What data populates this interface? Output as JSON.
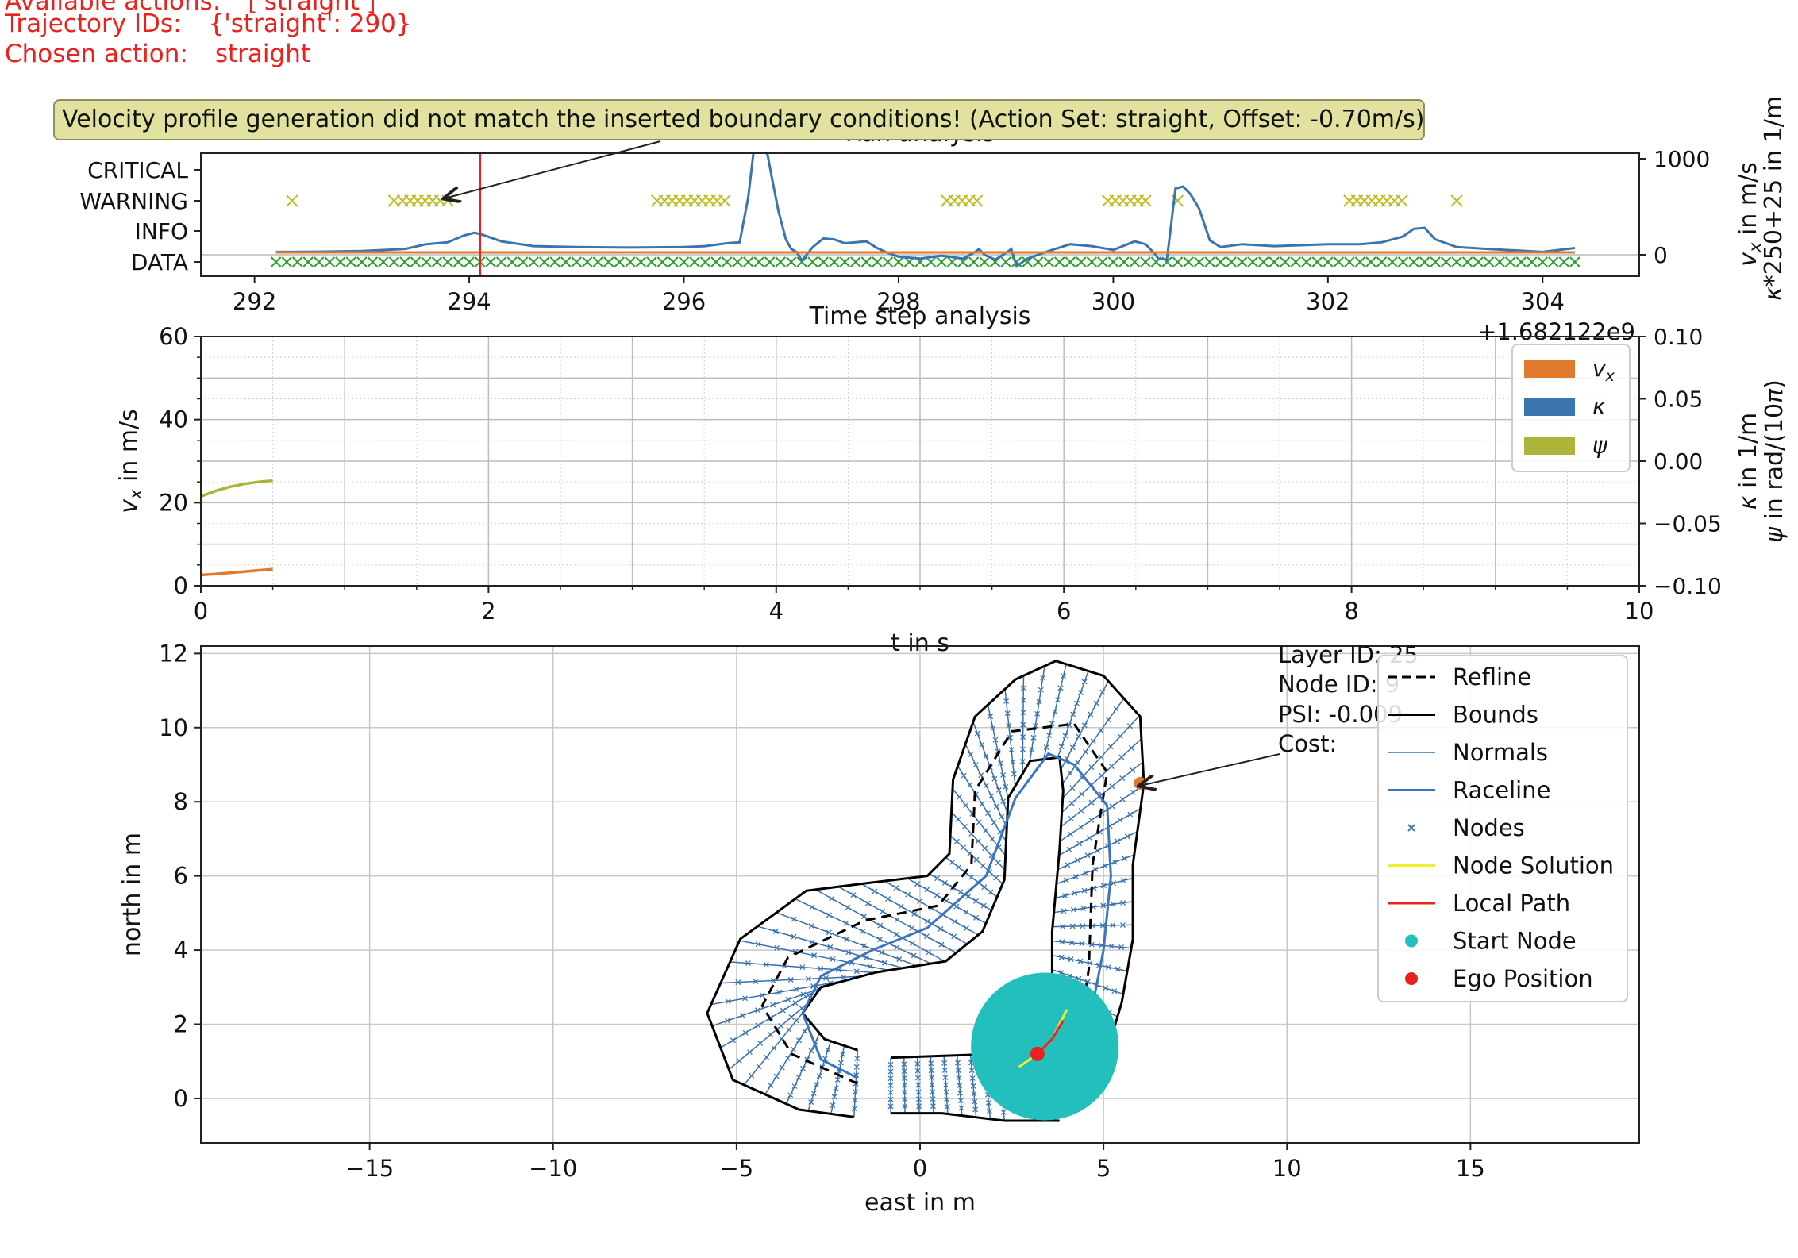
{
  "header": {
    "available_actions_label": "Available actions:",
    "available_actions_value": "['straight']",
    "trajectory_ids_label": "Trajectory IDs:",
    "trajectory_ids_value": "{'straight': 290}",
    "chosen_action_label": "Chosen action:",
    "chosen_action_value": "straight",
    "color": "#e8231f"
  },
  "warning_box": {
    "text": "Velocity profile generation did not match the inserted boundary conditions! (Action Set: straight, Offset: -0.70m/s)",
    "background": "#e2e2a0"
  },
  "chart_data": [
    {
      "type": "line",
      "title": "Run analysis",
      "xlim": [
        291.5,
        304.9
      ],
      "x_ticks": [
        "292",
        "294",
        "296",
        "298",
        "300",
        "302",
        "304"
      ],
      "x_offset_label": "+1.682122e9",
      "y_categories": [
        "DATA",
        "INFO",
        "WARNING",
        "CRITICAL"
      ],
      "y_right_label_1": "$v_x$ in m/s",
      "y_right_label_2": "$\\kappa$*250+25 in 1/m",
      "y_right_ticks": [
        "0",
        "1000"
      ],
      "selected_time": 294.1,
      "warning_marks_x": [
        292.35,
        293.3,
        293.38,
        293.45,
        293.52,
        293.59,
        293.66,
        293.73,
        293.8,
        295.75,
        295.82,
        295.89,
        295.96,
        296.03,
        296.1,
        296.17,
        296.24,
        296.31,
        296.38,
        298.45,
        298.52,
        298.59,
        298.66,
        298.73,
        299.95,
        300.02,
        300.09,
        300.16,
        300.23,
        300.3,
        300.6,
        302.2,
        302.27,
        302.34,
        302.41,
        302.48,
        302.55,
        302.62,
        302.69,
        303.2
      ],
      "data_marks": {
        "start": 292.2,
        "end": 304.3,
        "step": 0.1
      },
      "series": [
        {
          "name": "velocity",
          "color": "#3b75af",
          "x": [
            292.2,
            292.6,
            293,
            293.4,
            293.6,
            293.8,
            293.95,
            294.05,
            294.12,
            294.3,
            294.6,
            295,
            295.5,
            296,
            296.2,
            296.4,
            296.52,
            296.6,
            296.65,
            296.72,
            296.78,
            296.82,
            296.88,
            296.95,
            297,
            297.05,
            297.1,
            297.2,
            297.3,
            297.4,
            297.5,
            297.6,
            297.7,
            297.8,
            297.9,
            298,
            298.2,
            298.4,
            298.6,
            298.7,
            298.75,
            298.8,
            298.9,
            299,
            299.05,
            299.1,
            299.2,
            299.4,
            299.6,
            299.8,
            300,
            300.2,
            300.3,
            300.38,
            300.42,
            300.5,
            300.58,
            300.65,
            300.72,
            300.8,
            300.9,
            301,
            301.2,
            301.5,
            302,
            302.3,
            302.5,
            302.7,
            302.8,
            302.9,
            303,
            303.2,
            303.5,
            304,
            304.3
          ],
          "y": [
            30,
            32,
            40,
            60,
            110,
            130,
            200,
            230,
            210,
            140,
            90,
            80,
            75,
            80,
            90,
            120,
            130,
            600,
            1080,
            1160,
            1040,
            800,
            460,
            160,
            60,
            30,
            -60,
            80,
            170,
            160,
            120,
            130,
            140,
            70,
            20,
            -20,
            -40,
            -10,
            -40,
            20,
            60,
            0,
            -50,
            20,
            60,
            -120,
            -40,
            40,
            110,
            90,
            50,
            140,
            110,
            20,
            -40,
            -50,
            690,
            710,
            630,
            480,
            150,
            80,
            110,
            90,
            110,
            110,
            130,
            190,
            270,
            280,
            160,
            80,
            60,
            30,
            70
          ]
        },
        {
          "name": "curvature",
          "color": "#e07a2f",
          "x": [
            292.2,
            304.3
          ],
          "y": [
            25,
            25
          ]
        }
      ]
    },
    {
      "type": "line",
      "title": "Time step analysis",
      "xlabel": "t in s",
      "ylabel": "$v_x$ in m/s",
      "ylabel_right_1": "$\\kappa$ in 1/m",
      "ylabel_right_2": "$\\psi$ in rad/(10$\\pi$)",
      "xlim": [
        0,
        10
      ],
      "ylim": [
        0,
        60
      ],
      "ylim_right": [
        -0.1,
        0.1
      ],
      "x_ticks": [
        "0",
        "2",
        "4",
        "6",
        "8",
        "10"
      ],
      "y_ticks": [
        "0",
        "20",
        "40",
        "60"
      ],
      "y_right_ticks": [
        "−0.10",
        "−0.05",
        "0.00",
        "0.05",
        "0.10"
      ],
      "legend": [
        "v_x",
        "κ",
        "ψ"
      ],
      "legend_placement": "top-right",
      "grid": true,
      "series": [
        {
          "name": "v_x",
          "color": "#e07a2f",
          "x": [
            0,
            0.1,
            0.2,
            0.3,
            0.4,
            0.5
          ],
          "y": [
            2.6,
            2.8,
            3.1,
            3.4,
            3.7,
            4.0
          ]
        },
        {
          "name": "ψ",
          "color": "#adb43a",
          "x": [
            0,
            0.1,
            0.2,
            0.3,
            0.4,
            0.5
          ],
          "y": [
            21.5,
            22.8,
            23.8,
            24.5,
            25.0,
            25.3
          ]
        }
      ]
    },
    {
      "type": "scatter",
      "xlabel": "east in m",
      "ylabel": "north in m",
      "xlim": [
        -19.6,
        19.6
      ],
      "ylim": [
        -1.2,
        12.2
      ],
      "x_ticks": [
        "−15",
        "−10",
        "−5",
        "0",
        "5",
        "10",
        "15"
      ],
      "y_ticks": [
        "0",
        "2",
        "4",
        "6",
        "8",
        "10",
        "12"
      ],
      "grid": true,
      "legend": [
        "Refline",
        "Bounds",
        "Normals",
        "Raceline",
        "Nodes",
        "Node Solution",
        "Local Path",
        "Start Node",
        "Ego Position"
      ],
      "legend_placement": "top-right",
      "annotation": {
        "lines": [
          "Layer ID: 25",
          "Node ID: 9",
          "PSI: -0.009",
          "Cost:"
        ],
        "point": [
          6.0,
          8.5
        ]
      },
      "refline": [
        [
          -1.7,
          0.4
        ],
        [
          -3.5,
          1.2
        ],
        [
          -4.3,
          2.5
        ],
        [
          -3.6,
          3.8
        ],
        [
          -1.5,
          4.8
        ],
        [
          0.5,
          5.2
        ],
        [
          1.4,
          6.3
        ],
        [
          1.5,
          8.3
        ],
        [
          2.5,
          9.9
        ],
        [
          4.2,
          10.1
        ],
        [
          5.1,
          8.8
        ],
        [
          4.7,
          6.3
        ],
        [
          4.6,
          3.5
        ],
        [
          4.3,
          1.5
        ]
      ],
      "raceline": [
        [
          -1.7,
          0.55
        ],
        [
          -2.7,
          1.05
        ],
        [
          -3.2,
          2.3
        ],
        [
          -2.7,
          3.3
        ],
        [
          -1.3,
          4.0
        ],
        [
          0.2,
          4.6
        ],
        [
          1.8,
          6.0
        ],
        [
          2.6,
          8.1
        ],
        [
          3.5,
          9.3
        ],
        [
          4.2,
          9.0
        ],
        [
          5.1,
          7.9
        ],
        [
          5.2,
          6.0
        ],
        [
          5.0,
          4.0
        ],
        [
          4.7,
          2.5
        ],
        [
          4.3,
          1.2
        ]
      ],
      "bound_outer": [
        [
          -1.8,
          -0.5
        ],
        [
          -3.3,
          -0.3
        ],
        [
          -5.1,
          0.5
        ],
        [
          -5.8,
          2.3
        ],
        [
          -4.9,
          4.3
        ],
        [
          -3.1,
          5.6
        ],
        [
          -1.5,
          5.8
        ],
        [
          0.2,
          6.0
        ],
        [
          0.8,
          6.6
        ],
        [
          0.9,
          8.6
        ],
        [
          1.5,
          10.3
        ],
        [
          2.6,
          11.3
        ],
        [
          3.7,
          11.8
        ],
        [
          5.0,
          11.4
        ],
        [
          6.0,
          10.3
        ],
        [
          6.1,
          8.5
        ],
        [
          5.8,
          6.3
        ],
        [
          5.8,
          4.3
        ],
        [
          5.5,
          2.6
        ],
        [
          5.2,
          1.6
        ]
      ],
      "bound_inner": [
        [
          -1.7,
          1.3
        ],
        [
          -2.6,
          1.6
        ],
        [
          -3.2,
          2.3
        ],
        [
          -2.7,
          3.0
        ],
        [
          -1.2,
          3.4
        ],
        [
          0.7,
          3.7
        ],
        [
          1.7,
          4.5
        ],
        [
          2.3,
          5.9
        ],
        [
          2.4,
          8.1
        ],
        [
          3.0,
          9.1
        ],
        [
          3.8,
          9.2
        ],
        [
          3.9,
          8.3
        ],
        [
          3.8,
          6.7
        ],
        [
          3.6,
          4.5
        ],
        [
          3.6,
          2.7
        ]
      ],
      "bound_seg2_top": [
        [
          -0.8,
          1.1
        ],
        [
          2.1,
          1.2
        ]
      ],
      "bound_seg2_bottom": [
        [
          -0.8,
          -0.4
        ],
        [
          0.6,
          -0.4
        ],
        [
          2.3,
          -0.6
        ],
        [
          3.8,
          -0.6
        ]
      ],
      "ego": [
        3.2,
        1.2
      ],
      "start_node": {
        "x": 3.4,
        "y": 1.4,
        "size": "large"
      },
      "local_path": [
        [
          3.2,
          1.2
        ],
        [
          3.6,
          1.6
        ],
        [
          3.9,
          2.1
        ]
      ],
      "node_solution": [
        [
          2.7,
          0.85
        ],
        [
          3.2,
          1.2
        ],
        [
          3.6,
          1.6
        ],
        [
          4.0,
          2.4
        ]
      ],
      "colors": {
        "refline": "#000000",
        "bounds": "#000000",
        "normals": "#3b6fa8",
        "raceline": "#3b75c0",
        "nodes": "#3b75af",
        "node_solution": "#f0f030",
        "local_path": "#e8231f",
        "start_node": "#22bfbc",
        "ego": "#e8231f",
        "annotation_point": "#e07a2f"
      }
    }
  ]
}
